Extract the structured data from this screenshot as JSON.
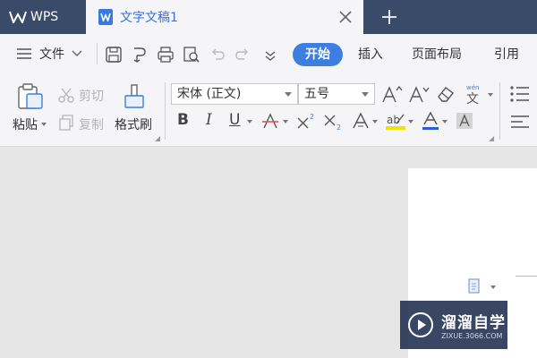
{
  "titlebar": {
    "app_tab": "WPS",
    "doc_tab": "文字文稿1"
  },
  "menubar": {
    "file": "文件",
    "tabs": [
      {
        "label": "开始",
        "active": true
      },
      {
        "label": "插入",
        "active": false
      },
      {
        "label": "页面布局",
        "active": false
      },
      {
        "label": "引用",
        "active": false
      }
    ]
  },
  "ribbon": {
    "paste": "粘贴",
    "cut": "剪切",
    "copy": "复制",
    "format_painter": "格式刷",
    "font_family": "宋体 (正文)",
    "font_size": "五号"
  },
  "watermark": {
    "main": "溜溜自学",
    "sub": "ZIXUE.3066.COM"
  },
  "colors": {
    "titlebar": "#3a4b6a",
    "accent": "#3d7fe0",
    "ribbon_bg": "#f5f5f7"
  }
}
